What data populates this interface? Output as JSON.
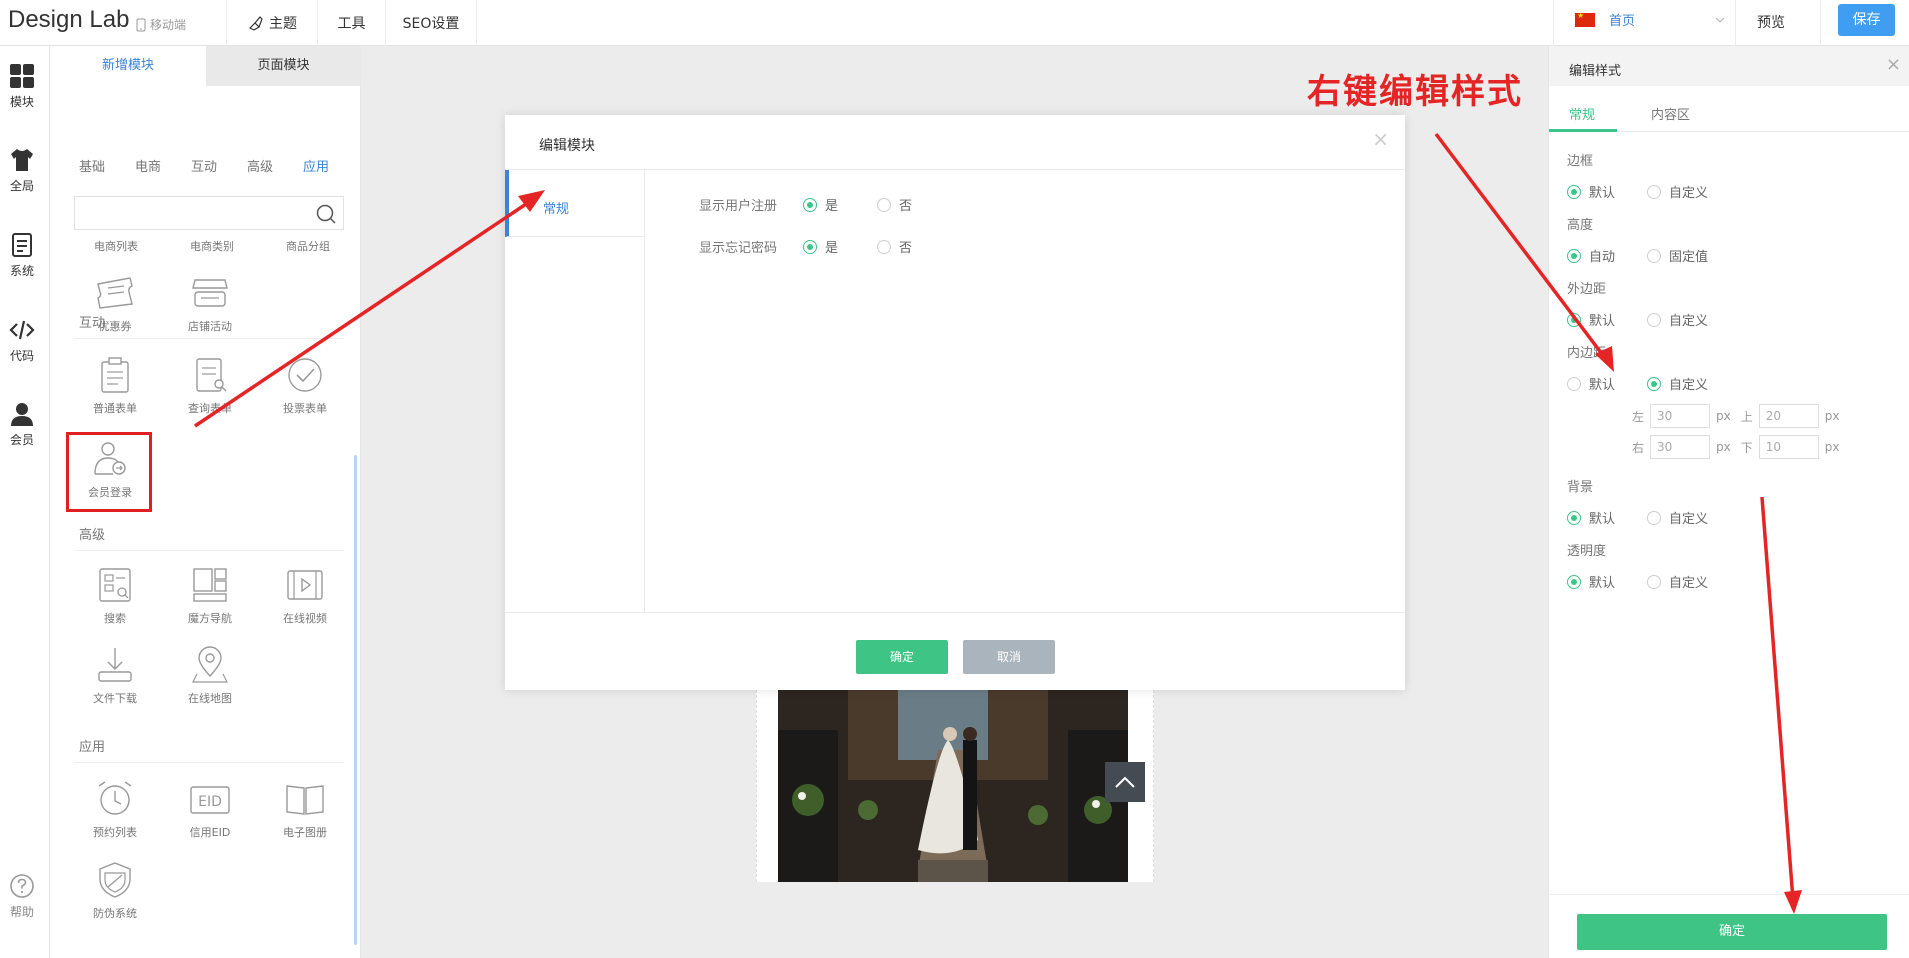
{
  "header": {
    "logo": "Design Lab",
    "mobile_label": "移动端",
    "nav": [
      "主题",
      "工具",
      "SEO设置"
    ],
    "page_select": "首页",
    "preview_label": "预览",
    "save_label": "保存"
  },
  "iconbar": {
    "items": [
      {
        "label": "模块",
        "icon": "modules-icon"
      },
      {
        "label": "全局",
        "icon": "shirt-icon"
      },
      {
        "label": "系统",
        "icon": "document-icon"
      },
      {
        "label": "代码",
        "icon": "code-icon"
      },
      {
        "label": "会员",
        "icon": "user-icon"
      }
    ],
    "help_label": "帮助"
  },
  "panel": {
    "tabs": [
      "新增模块",
      "页面模块"
    ],
    "categories": [
      "基础",
      "电商",
      "互动",
      "高级",
      "应用"
    ],
    "active_category": "应用",
    "search_placeholder": "",
    "top_row": [
      "电商列表",
      "电商类别",
      "商品分组"
    ],
    "shop_row": [
      "优惠券",
      "店铺活动"
    ],
    "sections": {
      "interact": {
        "title": "互动",
        "items": [
          "普通表单",
          "查询表单",
          "投票表单",
          "会员登录"
        ]
      },
      "advanced": {
        "title": "高级",
        "items": [
          "搜索",
          "魔方导航",
          "在线视频",
          "文件下载",
          "在线地图"
        ]
      },
      "apps": {
        "title": "应用",
        "items": [
          "预约列表",
          "信用EID",
          "电子图册",
          "防伪系统"
        ]
      }
    }
  },
  "dialog": {
    "title": "编辑模块",
    "close": "×",
    "tab": "常规",
    "rows": [
      {
        "label": "显示用户注册",
        "yes": "是",
        "no": "否",
        "value": "是"
      },
      {
        "label": "显示忘记密码",
        "yes": "是",
        "no": "否",
        "value": "是"
      }
    ],
    "ok_label": "确定",
    "cancel_label": "取消"
  },
  "annotation": "右键编辑样式",
  "style_panel": {
    "title": "编辑样式",
    "close": "×",
    "tabs": [
      "常规",
      "内容区"
    ],
    "groups": [
      {
        "label": "边框",
        "options": [
          "默认",
          "自定义"
        ],
        "selected": "默认"
      },
      {
        "label": "高度",
        "options": [
          "自动",
          "固定值"
        ],
        "selected": "自动"
      },
      {
        "label": "外边距",
        "options": [
          "默认",
          "自定义"
        ],
        "selected": "默认"
      },
      {
        "label": "内边距",
        "options": [
          "默认",
          "自定义"
        ],
        "selected": "自定义"
      },
      {
        "label": "背景",
        "options": [
          "默认",
          "自定义"
        ],
        "selected": "默认"
      },
      {
        "label": "透明度",
        "options": [
          "默认",
          "自定义"
        ],
        "selected": "默认"
      }
    ],
    "padding": {
      "left_label": "左",
      "left": "30",
      "top_label": "上",
      "top": "20",
      "right_label": "右",
      "right": "30",
      "bottom_label": "下",
      "bottom": "10",
      "unit": "px"
    },
    "confirm_label": "确定"
  },
  "colors": {
    "accent_green": "#3ec485",
    "accent_blue": "#3f9df2",
    "annotation_red": "#e52525"
  }
}
